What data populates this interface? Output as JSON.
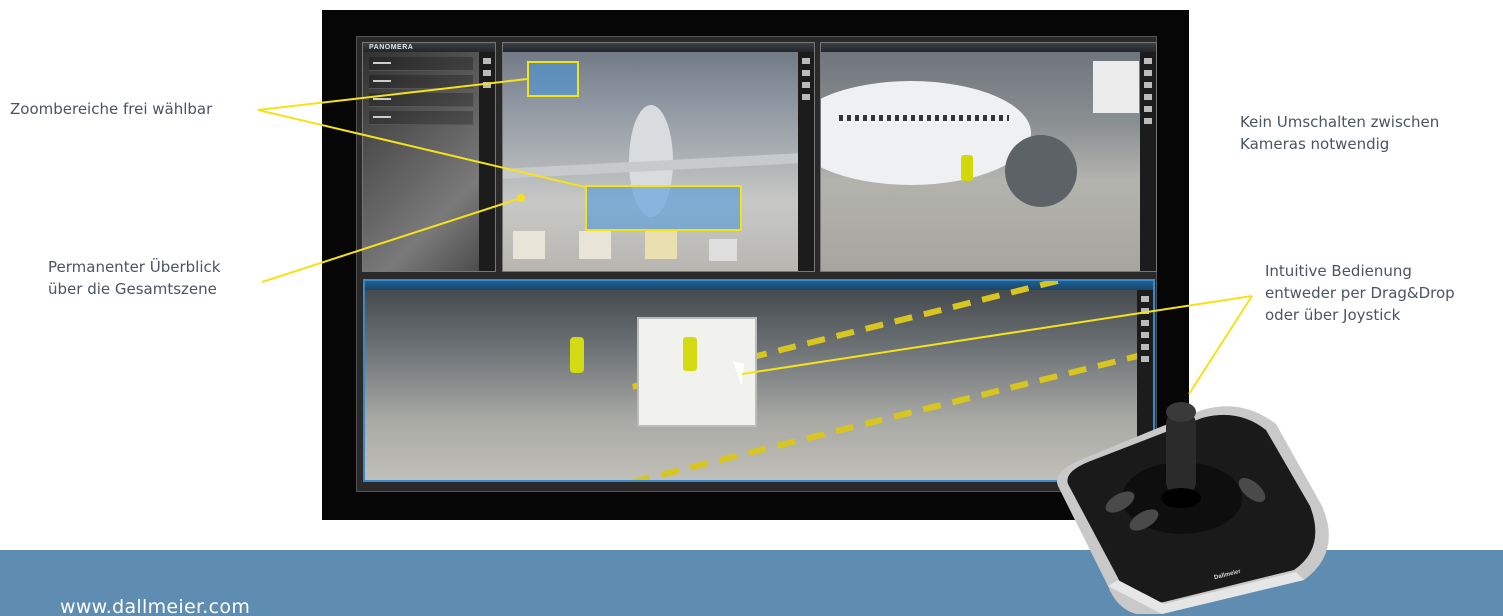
{
  "callouts": {
    "zoom_areas": "Zoombereiche frei wählbar",
    "overview_line1": "Permanenter Überblick",
    "overview_line2": "über die Gesamtszene",
    "no_switch_line1": "Kein Umschalten zwischen",
    "no_switch_line2": "Kameras notwendig",
    "intuitive_line1": "Intuitive Bedienung",
    "intuitive_line2": "entweder per Drag&Drop",
    "intuitive_line3": "oder über Joystick"
  },
  "app": {
    "brand": "PANOMERA"
  },
  "joystick": {
    "brand": "Dallmeier"
  },
  "footer": {
    "website": "www.dallmeier.com"
  },
  "colors": {
    "band": "#5f8db1",
    "callout_line": "#f4e21a",
    "zoom_fill": "#4696dc",
    "active_frame": "#3a8acb"
  },
  "icons": [
    "camera-icon",
    "record-icon",
    "save-icon",
    "print-icon",
    "info-icon",
    "settings-icon"
  ]
}
